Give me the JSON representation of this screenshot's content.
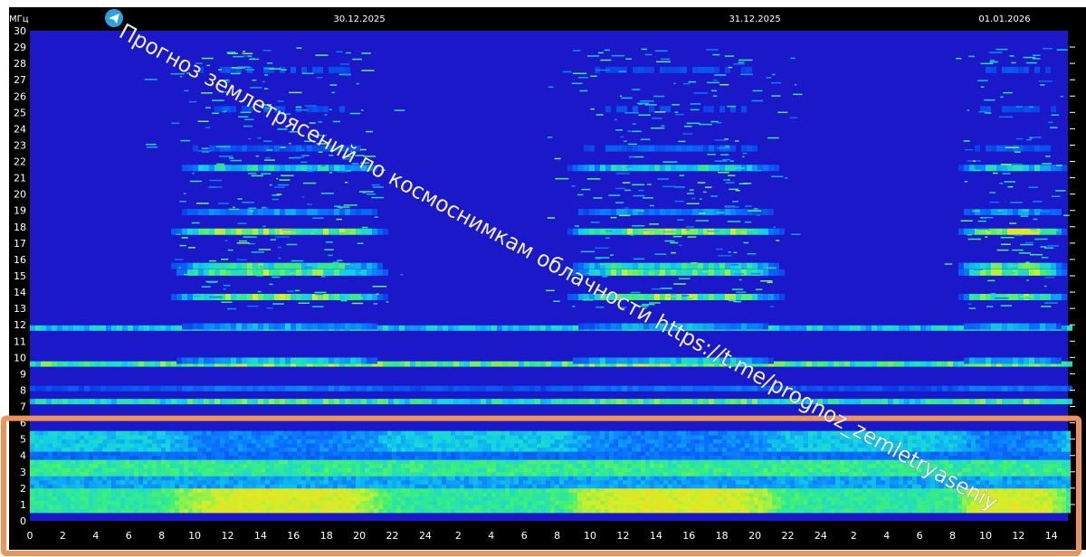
{
  "chart_data": {
    "type": "heatmap",
    "title": "",
    "ylabel": "МГц",
    "xlabel": "",
    "ylim": [
      0,
      30
    ],
    "yticks": [
      0,
      1,
      2,
      3,
      4,
      5,
      6,
      7,
      8,
      9,
      10,
      11,
      12,
      13,
      14,
      15,
      16,
      17,
      18,
      19,
      20,
      21,
      22,
      23,
      24,
      25,
      26,
      27,
      28,
      29,
      30
    ],
    "xticks": [
      "0",
      "2",
      "4",
      "6",
      "8",
      "10",
      "12",
      "14",
      "16",
      "18",
      "20",
      "22",
      "24",
      "2",
      "4",
      "6",
      "8",
      "10",
      "12",
      "14",
      "16",
      "18",
      "20",
      "22",
      "24",
      "2",
      "4",
      "6",
      "8",
      "10",
      "12",
      "14"
    ],
    "dates": [
      "30.12.2025",
      "31.12.2025",
      "01.01.2026"
    ],
    "x_range_hours": [
      0,
      63
    ],
    "date_marker_hours": [
      20,
      44,
      68
    ],
    "note_text": "",
    "colormap": [
      "#1414d2",
      "#0a3ce6",
      "#0a78ff",
      "#12d2e6",
      "#3cf078",
      "#d2f028",
      "#ffd21e"
    ],
    "background_color": "#1a18c8",
    "highlight_band_mhz": [
      0,
      6
    ],
    "highlight_color": "#f0935a",
    "persistent_bands": [
      {
        "freq_mhz": 7.3,
        "intensity": 0.75
      },
      {
        "freq_mhz": 9.6,
        "intensity": 0.85
      },
      {
        "freq_mhz": 11.8,
        "intensity": 0.65
      },
      {
        "freq_mhz": 8.1,
        "intensity": 0.3
      }
    ],
    "daytime_bands": [
      {
        "freq_mhz": 13.7,
        "intensity": 0.85
      },
      {
        "freq_mhz": 15.2,
        "intensity": 0.85
      },
      {
        "freq_mhz": 15.6,
        "intensity": 0.75
      },
      {
        "freq_mhz": 17.7,
        "intensity": 0.9
      },
      {
        "freq_mhz": 18.9,
        "intensity": 0.45
      },
      {
        "freq_mhz": 21.6,
        "intensity": 0.65
      },
      {
        "freq_mhz": 22.8,
        "intensity": 0.3
      },
      {
        "freq_mhz": 25.2,
        "intensity": 0.25
      },
      {
        "freq_mhz": 27.6,
        "intensity": 0.25
      },
      {
        "freq_mhz": 9.8,
        "intensity": 0.6
      },
      {
        "freq_mhz": 11.9,
        "intensity": 0.5
      }
    ],
    "daytime_windows_hours": [
      [
        8,
        22
      ],
      [
        32,
        46
      ],
      [
        56,
        63
      ]
    ],
    "low_band_mhz": [
      0.5,
      5.5
    ]
  },
  "watermark": {
    "text": "Прогноз землетрясений по космоснимкам облачности  https://t.me/prognoz_zemletryaseniy",
    "icon": "telegram-icon"
  }
}
